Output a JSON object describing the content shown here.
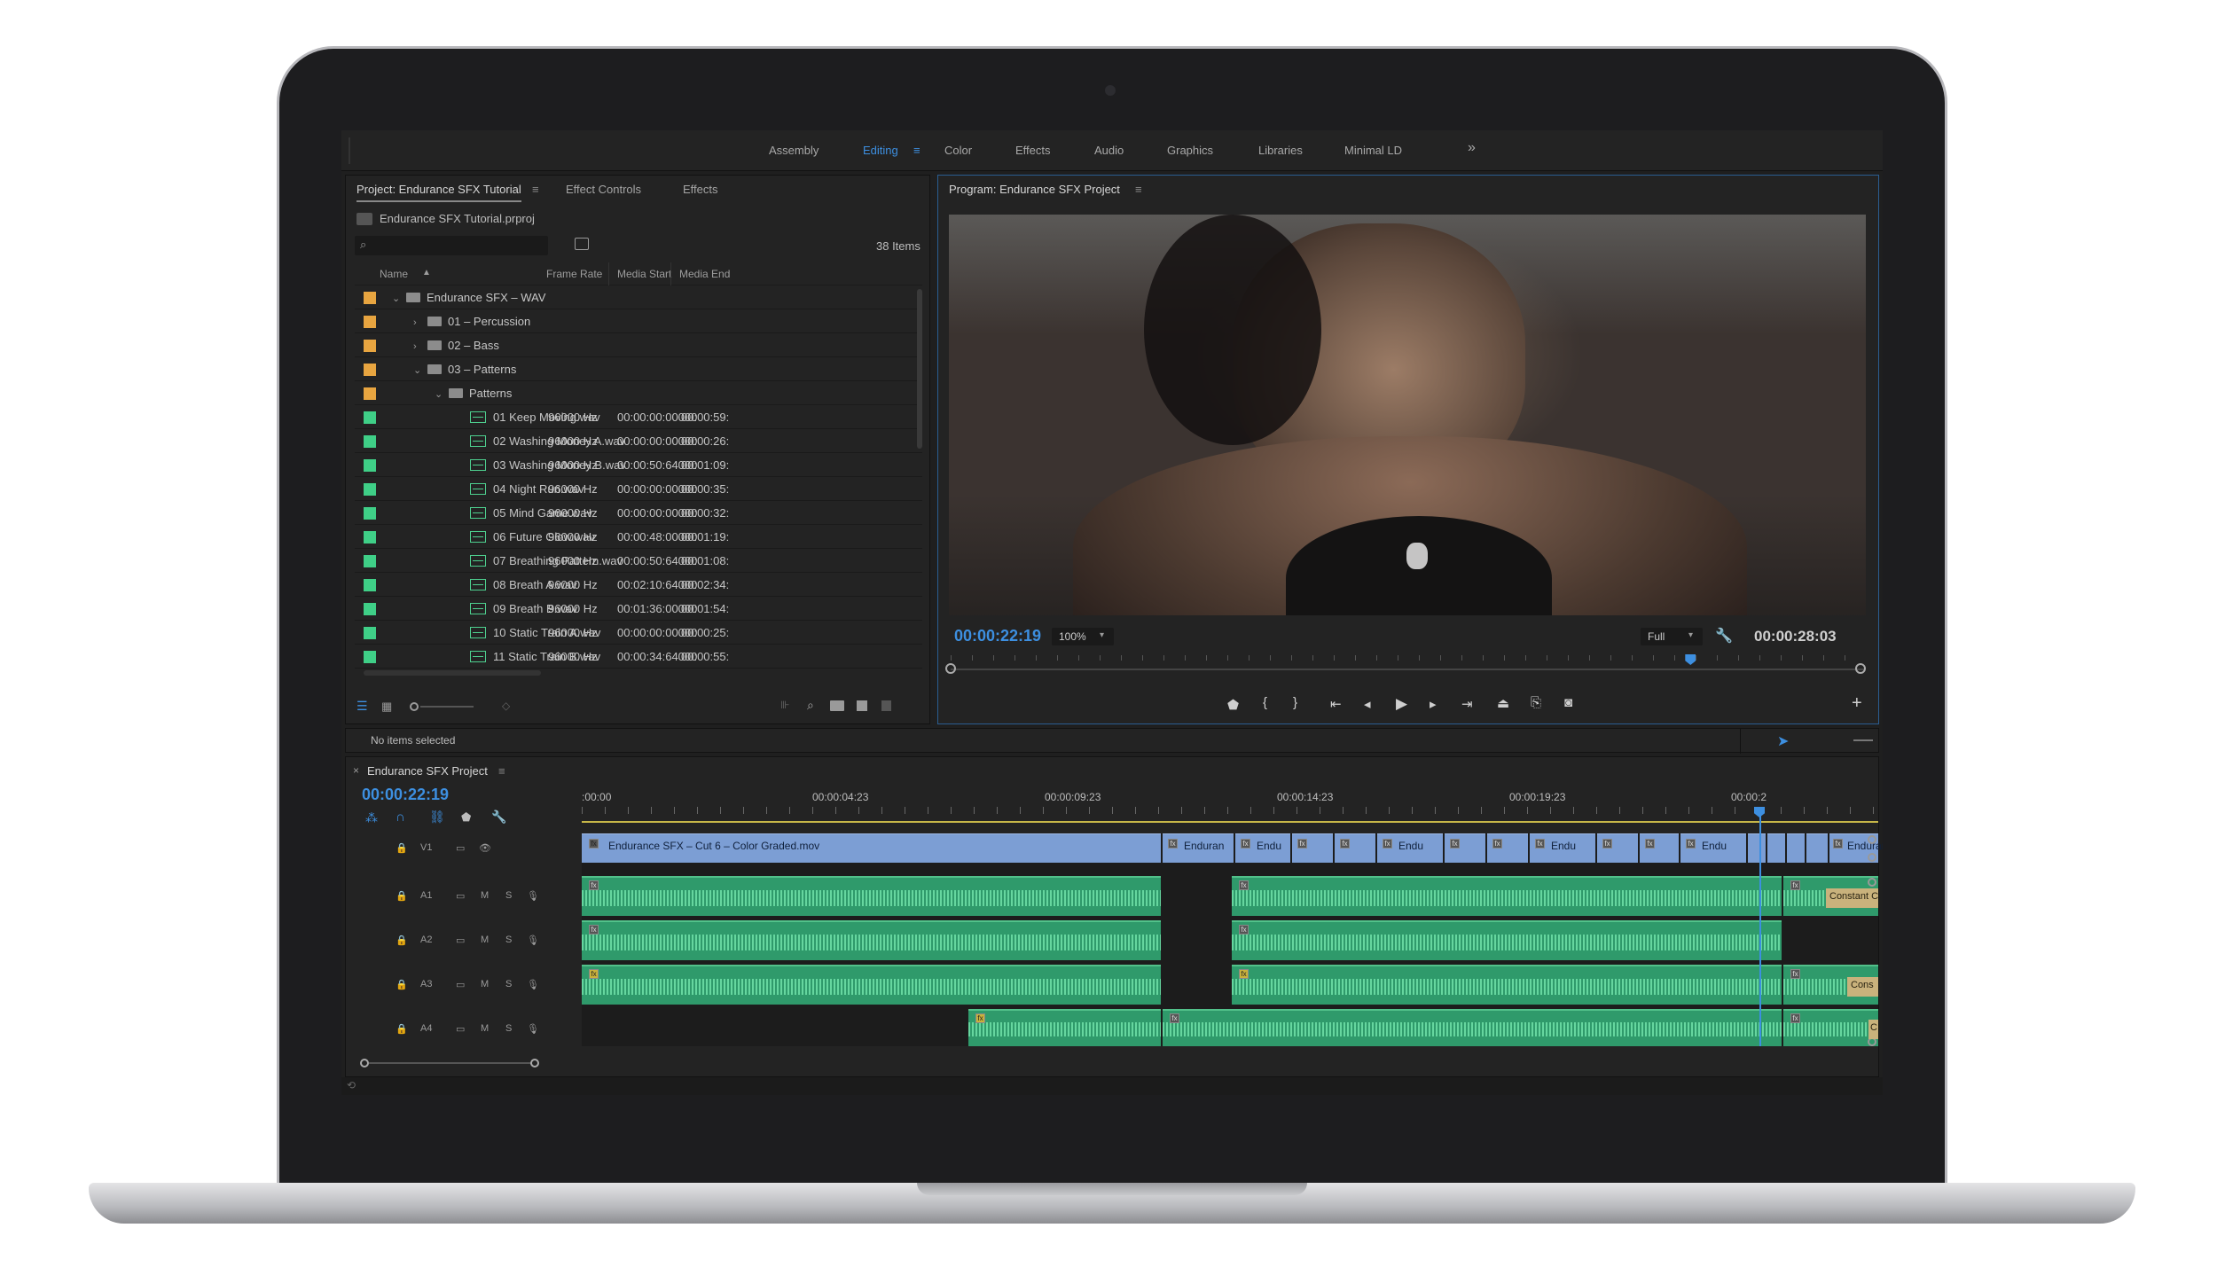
{
  "workspaces": [
    "Assembly",
    "Editing",
    "Color",
    "Effects",
    "Audio",
    "Graphics",
    "Libraries",
    "Minimal LD"
  ],
  "workspace_overflow": "»",
  "project_panel": {
    "tabs": [
      "Project: Endurance SFX Tutorial",
      "Effect Controls",
      "Effects"
    ],
    "project_file": "Endurance SFX Tutorial.prproj",
    "item_count": "38 Items",
    "search_placeholder": "",
    "columns": [
      "Name",
      "Frame Rate",
      "Media Start",
      "Media End"
    ],
    "rows": [
      {
        "name": "Endurance SFX – WAV",
        "rate": "",
        "start": "",
        "end": "",
        "type": "folder",
        "depth": 0,
        "chev": "v",
        "color": "#e8a540"
      },
      {
        "name": "01 – Percussion",
        "rate": "",
        "start": "",
        "end": "",
        "type": "folder",
        "depth": 1,
        "chev": ">",
        "color": "#e8a540"
      },
      {
        "name": "02 – Bass",
        "rate": "",
        "start": "",
        "end": "",
        "type": "folder",
        "depth": 1,
        "chev": ">",
        "color": "#e8a540"
      },
      {
        "name": "03 – Patterns",
        "rate": "",
        "start": "",
        "end": "",
        "type": "folder",
        "depth": 1,
        "chev": "v",
        "color": "#e8a540"
      },
      {
        "name": "Patterns",
        "rate": "",
        "start": "",
        "end": "",
        "type": "folder",
        "depth": 2,
        "chev": "v",
        "color": "#e8a540"
      },
      {
        "name": "01 Keep Moving.wav",
        "rate": "96000 Hz",
        "start": "00:00:00:00000",
        "end": "00:00:59:",
        "type": "audio",
        "depth": 3,
        "chev": "",
        "color": "#3fcf87"
      },
      {
        "name": "02 Washing Money A.wav",
        "rate": "96000 Hz",
        "start": "00:00:00:00000",
        "end": "00:00:26:",
        "type": "audio",
        "depth": 3,
        "chev": "",
        "color": "#3fcf87"
      },
      {
        "name": "03 Washing Money B.wav",
        "rate": "96000 Hz",
        "start": "00:00:50:64000",
        "end": "00:01:09:",
        "type": "audio",
        "depth": 3,
        "chev": "",
        "color": "#3fcf87"
      },
      {
        "name": "04 Night Run.wav",
        "rate": "96000 Hz",
        "start": "00:00:00:00000",
        "end": "00:00:35:",
        "type": "audio",
        "depth": 3,
        "chev": "",
        "color": "#3fcf87"
      },
      {
        "name": "05 Mind Game.wav",
        "rate": "96000 Hz",
        "start": "00:00:00:00000",
        "end": "00:00:32:",
        "type": "audio",
        "depth": 3,
        "chev": "",
        "color": "#3fcf87"
      },
      {
        "name": "06 Future Glow.wav",
        "rate": "96000 Hz",
        "start": "00:00:48:00000",
        "end": "00:01:19:",
        "type": "audio",
        "depth": 3,
        "chev": "",
        "color": "#3fcf87"
      },
      {
        "name": "07 Breathing Pattern.wav",
        "rate": "96000 Hz",
        "start": "00:00:50:64000",
        "end": "00:01:08:",
        "type": "audio",
        "depth": 3,
        "chev": "",
        "color": "#3fcf87"
      },
      {
        "name": "08 Breath A.wav",
        "rate": "96000 Hz",
        "start": "00:02:10:64000",
        "end": "00:02:34:",
        "type": "audio",
        "depth": 3,
        "chev": "",
        "color": "#3fcf87"
      },
      {
        "name": "09 Breath B.wav",
        "rate": "96000 Hz",
        "start": "00:01:36:00000",
        "end": "00:01:54:",
        "type": "audio",
        "depth": 3,
        "chev": "",
        "color": "#3fcf87"
      },
      {
        "name": "10 Static Train A.wav",
        "rate": "96000 Hz",
        "start": "00:00:00:00000",
        "end": "00:00:25:",
        "type": "audio",
        "depth": 3,
        "chev": "",
        "color": "#3fcf87"
      },
      {
        "name": "11 Static Train B.wav",
        "rate": "96000 Hz",
        "start": "00:00:34:64000",
        "end": "00:00:55:",
        "type": "audio",
        "depth": 3,
        "chev": "",
        "color": "#3fcf87"
      }
    ]
  },
  "program_monitor": {
    "title": "Program: Endurance SFX Project",
    "current_time": "00:00:22:19",
    "zoom": "100%",
    "quality": "Full",
    "duration": "00:00:28:03",
    "playhead_fraction": 0.81
  },
  "status": {
    "selection": "No items selected"
  },
  "timeline": {
    "sequence_name": "Endurance SFX Project",
    "current_time": "00:00:22:19",
    "ruler_labels": [
      ":00:00",
      "00:00:04:23",
      "00:00:09:23",
      "00:00:14:23",
      "00:00:19:23",
      "00:00:2"
    ],
    "tracks": [
      {
        "name": "V1"
      },
      {
        "name": "A1"
      },
      {
        "name": "A2"
      },
      {
        "name": "A3"
      },
      {
        "name": "A4"
      }
    ],
    "track_buttons": {
      "mute": "M",
      "solo": "S"
    },
    "video_clip_main": "Endurance SFX – Cut 6 – Color Graded.mov",
    "video_clip_short_1": "Enduran",
    "video_clip_short_2": "Endu",
    "video_clip_short_3": "Endu",
    "video_clip_short_4": "Endu",
    "video_clip_short_5": "Endu",
    "video_clip_end": "Endurance SF",
    "transition_label_1": "Constant C",
    "transition_label_2": "Cons",
    "transition_label_3": "C"
  }
}
